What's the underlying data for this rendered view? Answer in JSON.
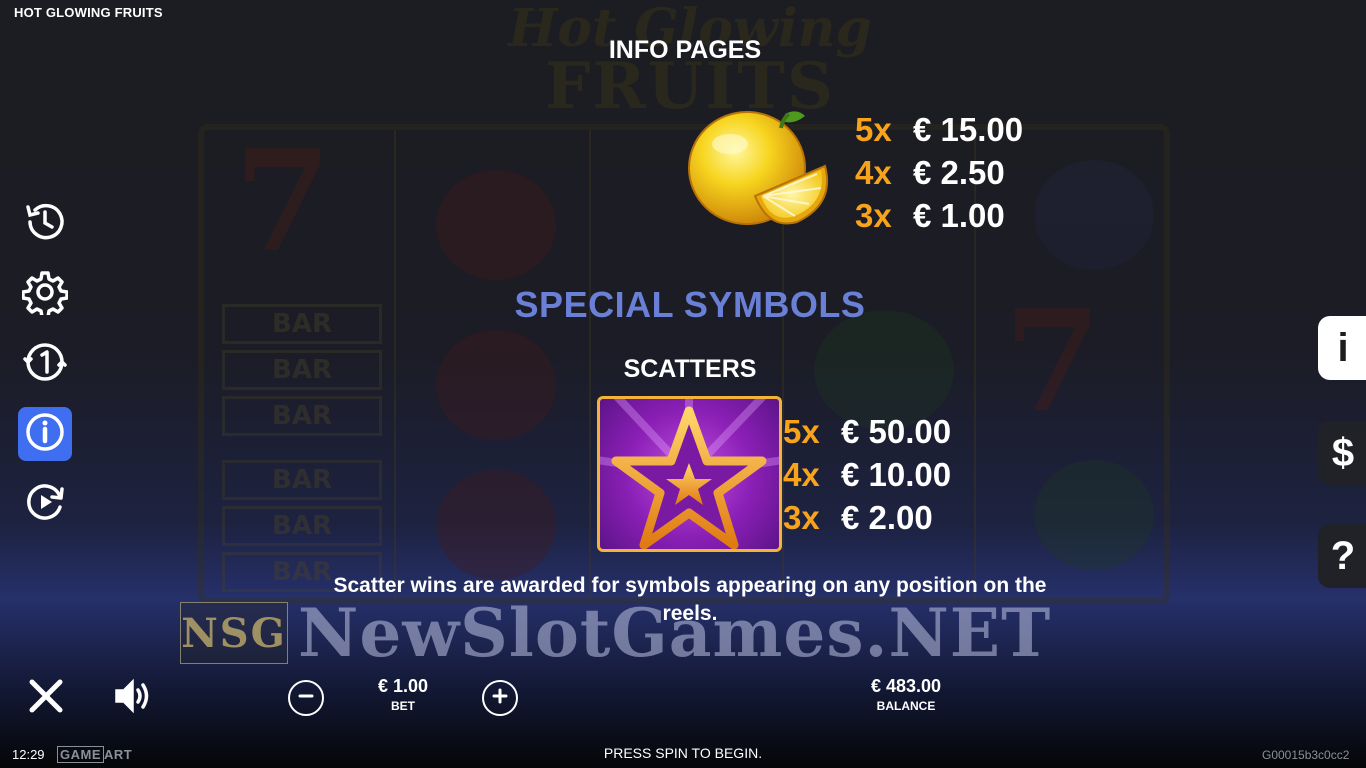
{
  "game": {
    "title": "HOT GLOWING FRUITS",
    "background_title_line1": "Hot Glowing",
    "background_title_line2": "FRUITS"
  },
  "background_reels": {
    "bar_label": "BAR",
    "seven_label": "7"
  },
  "info": {
    "heading": "INFO PAGES",
    "lemon_symbol": {
      "icon": "lemon-icon",
      "payouts": [
        {
          "count": "5x",
          "amount": "€ 15.00"
        },
        {
          "count": "4x",
          "amount": "€ 2.50"
        },
        {
          "count": "3x",
          "amount": "€ 1.00"
        }
      ]
    },
    "special_heading": "SPECIAL SYMBOLS",
    "scatters_heading": "SCATTERS",
    "scatter_symbol": {
      "icon": "star-scatter-icon",
      "payouts": [
        {
          "count": "5x",
          "amount": "€ 50.00"
        },
        {
          "count": "4x",
          "amount": "€ 10.00"
        },
        {
          "count": "3x",
          "amount": "€ 2.00"
        }
      ]
    },
    "scatter_description": "Scatter wins are awarded for symbols appearing on any position on the reels."
  },
  "sidebar": {
    "items": [
      {
        "icon": "history-icon",
        "active": false
      },
      {
        "icon": "settings-gear-icon",
        "active": false
      },
      {
        "icon": "autoplay-icon",
        "active": false
      },
      {
        "icon": "info-icon",
        "active": true
      },
      {
        "icon": "replay-icon",
        "active": false
      }
    ]
  },
  "right_tabs": [
    {
      "label": "i",
      "active": true
    },
    {
      "label": "$",
      "active": false
    },
    {
      "label": "?",
      "active": false
    }
  ],
  "watermark": {
    "logo_text": "NSG",
    "text": "NewSlotGames.NET"
  },
  "controls": {
    "bet_value": "€ 1.00",
    "bet_label": "BET",
    "balance_value": "€ 483.00",
    "balance_label": "BALANCE"
  },
  "footer": {
    "time": "12:29",
    "brand_part1": "GAME",
    "brand_part2": "ART",
    "message": "PRESS SPIN TO BEGIN.",
    "build_id": "G00015b3c0cc2"
  },
  "colors": {
    "payout_count": "#f7a31c",
    "special_heading": "#6a7fd6",
    "active_button": "#3f6ff0",
    "scatter_border": "#f2b33a"
  }
}
